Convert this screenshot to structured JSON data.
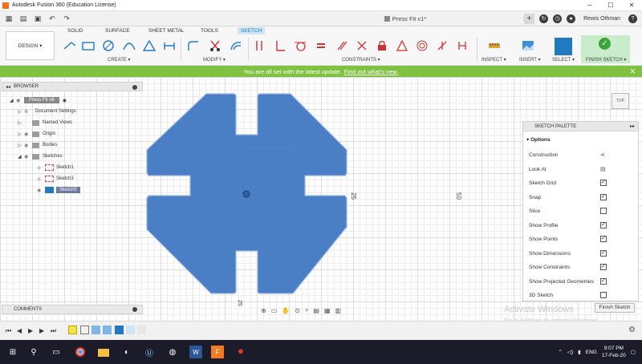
{
  "window": {
    "title": "Autodesk Fusion 360 (Education License)",
    "minimize": "─",
    "maximize": "☐",
    "close": "✕"
  },
  "document_tab": {
    "label": "Press Fit v1*",
    "close": "×"
  },
  "account": {
    "user": "Rewis Othman",
    "new_tab": "+"
  },
  "workspace": {
    "label": "DESIGN ▾"
  },
  "ribbon_tabs": [
    {
      "label": "SOLID",
      "active": false
    },
    {
      "label": "SURFACE",
      "active": false
    },
    {
      "label": "SHEET METAL",
      "active": false
    },
    {
      "label": "TOOLS",
      "active": false
    },
    {
      "label": "SKETCH",
      "active": true
    }
  ],
  "groups": {
    "create": "CREATE ▾",
    "modify": "MODIFY ▾",
    "constraints": "CONSTRAINTS ▾",
    "inspect": "INSPECT ▾",
    "insert": "INSERT ▾",
    "select": "SELECT ▾",
    "finish": "FINISH SKETCH ▾"
  },
  "banner": {
    "message": "You are all set with the latest update.",
    "link": "Find out what's new.",
    "close": "✕"
  },
  "browser": {
    "title": "BROWSER",
    "root": "Press Fit v6",
    "items": [
      {
        "label": "Document Settings"
      },
      {
        "label": "Named Views"
      },
      {
        "label": "Origin"
      },
      {
        "label": "Bodies"
      },
      {
        "label": "Sketches"
      }
    ],
    "sketches": [
      "Sketch1",
      "Sketch3",
      "Sketch5"
    ]
  },
  "viewcube": {
    "label": "TOP"
  },
  "dimensions": {
    "d1": "25",
    "d2": "50",
    "d3": "25"
  },
  "palette": {
    "title": "SKETCH PALETTE",
    "section": "Options",
    "rows": [
      {
        "label": "Construction",
        "kind": "icon",
        "checked": false
      },
      {
        "label": "Look At",
        "kind": "icon",
        "checked": false
      },
      {
        "label": "Sketch Grid",
        "kind": "check",
        "checked": true
      },
      {
        "label": "Snap",
        "kind": "check",
        "checked": true
      },
      {
        "label": "Slice",
        "kind": "check",
        "checked": false
      },
      {
        "label": "Show Profile",
        "kind": "check",
        "checked": true
      },
      {
        "label": "Show Points",
        "kind": "check",
        "checked": true
      },
      {
        "label": "Show Dimensions",
        "kind": "check",
        "checked": true
      },
      {
        "label": "Show Constraints",
        "kind": "check",
        "checked": true
      },
      {
        "label": "Show Projected Geometries",
        "kind": "check",
        "checked": true
      },
      {
        "label": "3D Sketch",
        "kind": "check",
        "checked": false
      }
    ],
    "finish_button": "Finish Sketch"
  },
  "watermark": {
    "line1": "Activate Windows",
    "line2": "Go to Settings to activate Windows."
  },
  "comments": {
    "label": "COMMENTS"
  },
  "taskbar": {
    "lang": "ENG",
    "time": "9:07 PM",
    "date": "17-Feb-20"
  },
  "colors": {
    "profile_fill": "#4a7ec5",
    "accent": "#1f7ac2",
    "banner": "#7fc241",
    "finish": "#39a53a"
  }
}
